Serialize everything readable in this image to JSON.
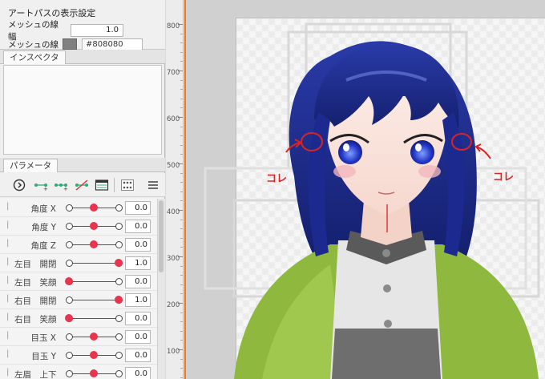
{
  "art_path_settings": {
    "title": "アートパスの表示設定",
    "mesh_line_width_label": "メッシュの線幅",
    "mesh_line_width_value": "1.0",
    "mesh_line_color_label": "メッシュの線色",
    "mesh_line_color_value": "#808080"
  },
  "inspector": {
    "tab_label": "インスペクタ"
  },
  "parameters": {
    "tab_label": "パラメータ",
    "toolbar_icons": [
      "play-circle-icon",
      "add-key-icon",
      "add-keys-icon",
      "remove-keys-icon",
      "keyform-table-icon",
      "parameter-group-icon",
      "menu-icon"
    ],
    "rows": [
      {
        "name": "角度 X",
        "value": "0.0",
        "position": 0.5
      },
      {
        "name": "角度 Y",
        "value": "0.0",
        "position": 0.5
      },
      {
        "name": "角度 Z",
        "value": "0.0",
        "position": 0.5
      },
      {
        "name": "左目　開閉",
        "value": "1.0",
        "position": 1.0
      },
      {
        "name": "左目　笑顔",
        "value": "0.0",
        "position": 0.0
      },
      {
        "name": "右目　開閉",
        "value": "1.0",
        "position": 1.0
      },
      {
        "name": "右目　笑顔",
        "value": "0.0",
        "position": 0.0
      },
      {
        "name": "目玉 X",
        "value": "0.0",
        "position": 0.5
      },
      {
        "name": "目玉 Y",
        "value": "0.0",
        "position": 0.5
      },
      {
        "name": "左眉　上下",
        "value": "0.0",
        "position": 0.5
      }
    ]
  },
  "ruler": {
    "labels": [
      "800",
      "700",
      "600",
      "500",
      "400",
      "300",
      "200",
      "100"
    ]
  },
  "canvas": {
    "annotation_left": "コレ",
    "annotation_right": "コレ",
    "annotation_color": "#dd2222"
  }
}
